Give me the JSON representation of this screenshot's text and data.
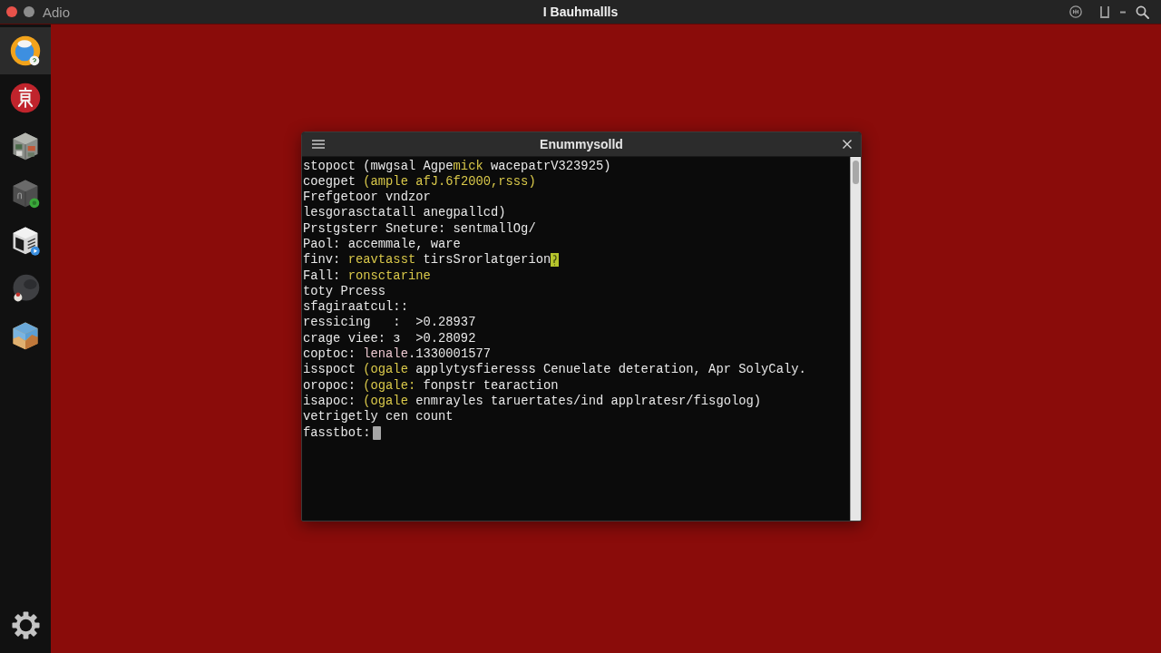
{
  "top_bar": {
    "app_name": "Adio",
    "title": "I Bauhmallls"
  },
  "dock": {
    "items": [
      {
        "kind": "ring",
        "selected": true
      },
      {
        "kind": "glyph",
        "selected": false
      },
      {
        "kind": "blocks",
        "selected": false
      },
      {
        "kind": "box",
        "selected": false
      },
      {
        "kind": "monitor",
        "selected": false
      },
      {
        "kind": "sphere",
        "selected": false
      },
      {
        "kind": "landscape",
        "selected": false
      }
    ]
  },
  "terminal": {
    "title": "Enummysolld",
    "lines": [
      [
        {
          "kind": "plain",
          "text": "stopoct (mwgsal Agpe"
        },
        {
          "kind": "accent",
          "text": "mick"
        },
        {
          "kind": "plain",
          "text": " wacepatrV323925)"
        }
      ],
      [
        {
          "kind": "plain",
          "text": "coegpet "
        },
        {
          "kind": "accent",
          "text": "(ample afJ.6f2000,rsss)"
        }
      ],
      [
        {
          "kind": "plain",
          "text": "Frefgetoor vndzor"
        }
      ],
      [
        {
          "kind": "plain",
          "text": "lesgorasctatall anegpallcd)"
        }
      ],
      [
        {
          "kind": "plain",
          "text": "Prstgsterr Sneture: sentmallOg/"
        }
      ],
      [
        {
          "kind": "plain",
          "text": "Paol: accemmale, ware"
        }
      ],
      [
        {
          "kind": "plain",
          "text": "finv: "
        },
        {
          "kind": "accent",
          "text": "reavtasst"
        },
        {
          "kind": "plain",
          "text": " tirsSrorlatgerion"
        },
        {
          "kind": "highlight-cursor"
        }
      ],
      [
        {
          "kind": "plain",
          "text": "Fall: "
        },
        {
          "kind": "accent",
          "text": "ronsctarine"
        }
      ],
      [
        {
          "kind": "plain",
          "text": "toty Prcess"
        }
      ],
      [
        {
          "kind": "plain",
          "text": "sfagiraatcul::"
        }
      ],
      [
        {
          "kind": "plain",
          "text": "ressicing   :  >0.28937"
        }
      ],
      [
        {
          "kind": "plain",
          "text": "crage viee: з  >0.28092"
        }
      ],
      [
        {
          "kind": "plain",
          "text": "coptoc: "
        },
        {
          "kind": "muted",
          "text": "lenale"
        },
        {
          "kind": "plain",
          "text": ".1330001577"
        }
      ],
      [
        {
          "kind": "plain",
          "text": "isspoct "
        },
        {
          "kind": "accent",
          "text": "(ogale"
        },
        {
          "kind": "plain",
          "text": " applytysfieresss Cenuelate deteration, Apr SolyCaly."
        }
      ],
      [
        {
          "kind": "plain",
          "text": "oropoc: "
        },
        {
          "kind": "accent",
          "text": "(ogale:"
        },
        {
          "kind": "plain",
          "text": " fonpstr tearaction"
        }
      ],
      [
        {
          "kind": "plain",
          "text": "isapoc: "
        },
        {
          "kind": "accent",
          "text": "(ogale"
        },
        {
          "kind": "plain",
          "text": " enmrayles taruertates/ind applratesr/fisgolog)"
        }
      ],
      [
        {
          "kind": "plain",
          "text": "vetrigetly cen count"
        }
      ],
      [
        {
          "kind": "plain",
          "text": "fasstbot:"
        },
        {
          "kind": "cursor"
        }
      ]
    ]
  }
}
